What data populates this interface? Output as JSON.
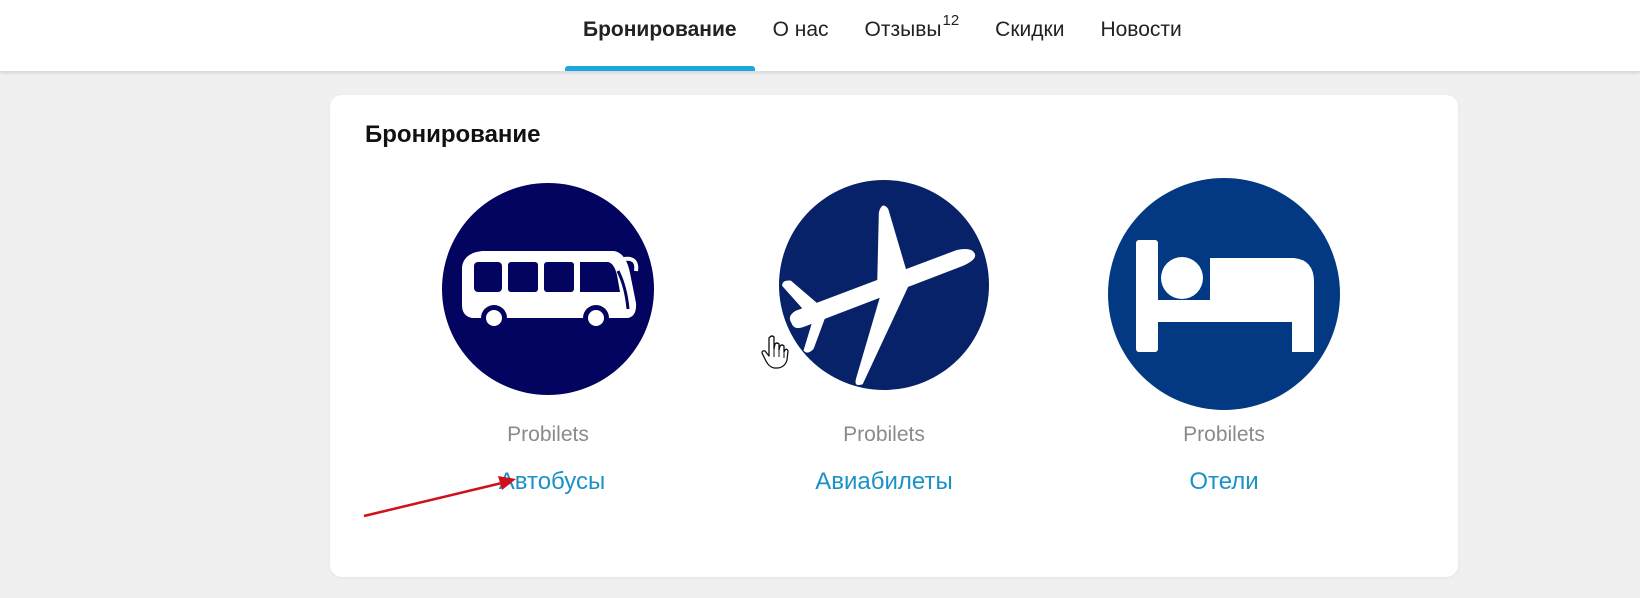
{
  "nav": {
    "tabs": [
      {
        "label": "Бронирование",
        "active": true
      },
      {
        "label": "О нас",
        "active": false
      },
      {
        "label": "Отзывы",
        "badge": "12",
        "active": false
      },
      {
        "label": "Скидки",
        "active": false
      },
      {
        "label": "Новости",
        "active": false
      }
    ]
  },
  "booking": {
    "title": "Бронирование",
    "items": [
      {
        "brand": "Probilets",
        "label": "Автобусы",
        "icon": "bus-icon",
        "color": "#020460"
      },
      {
        "brand": "Probilets",
        "label": "Авиабилеты",
        "icon": "airplane-icon",
        "color": "#072268"
      },
      {
        "brand": "Probilets",
        "label": "Отели",
        "icon": "bed-icon",
        "color": "#033882"
      }
    ]
  },
  "colors": {
    "accent": "#1aa7e0",
    "link": "#1b92c7",
    "annotation_arrow": "#d0101a"
  }
}
